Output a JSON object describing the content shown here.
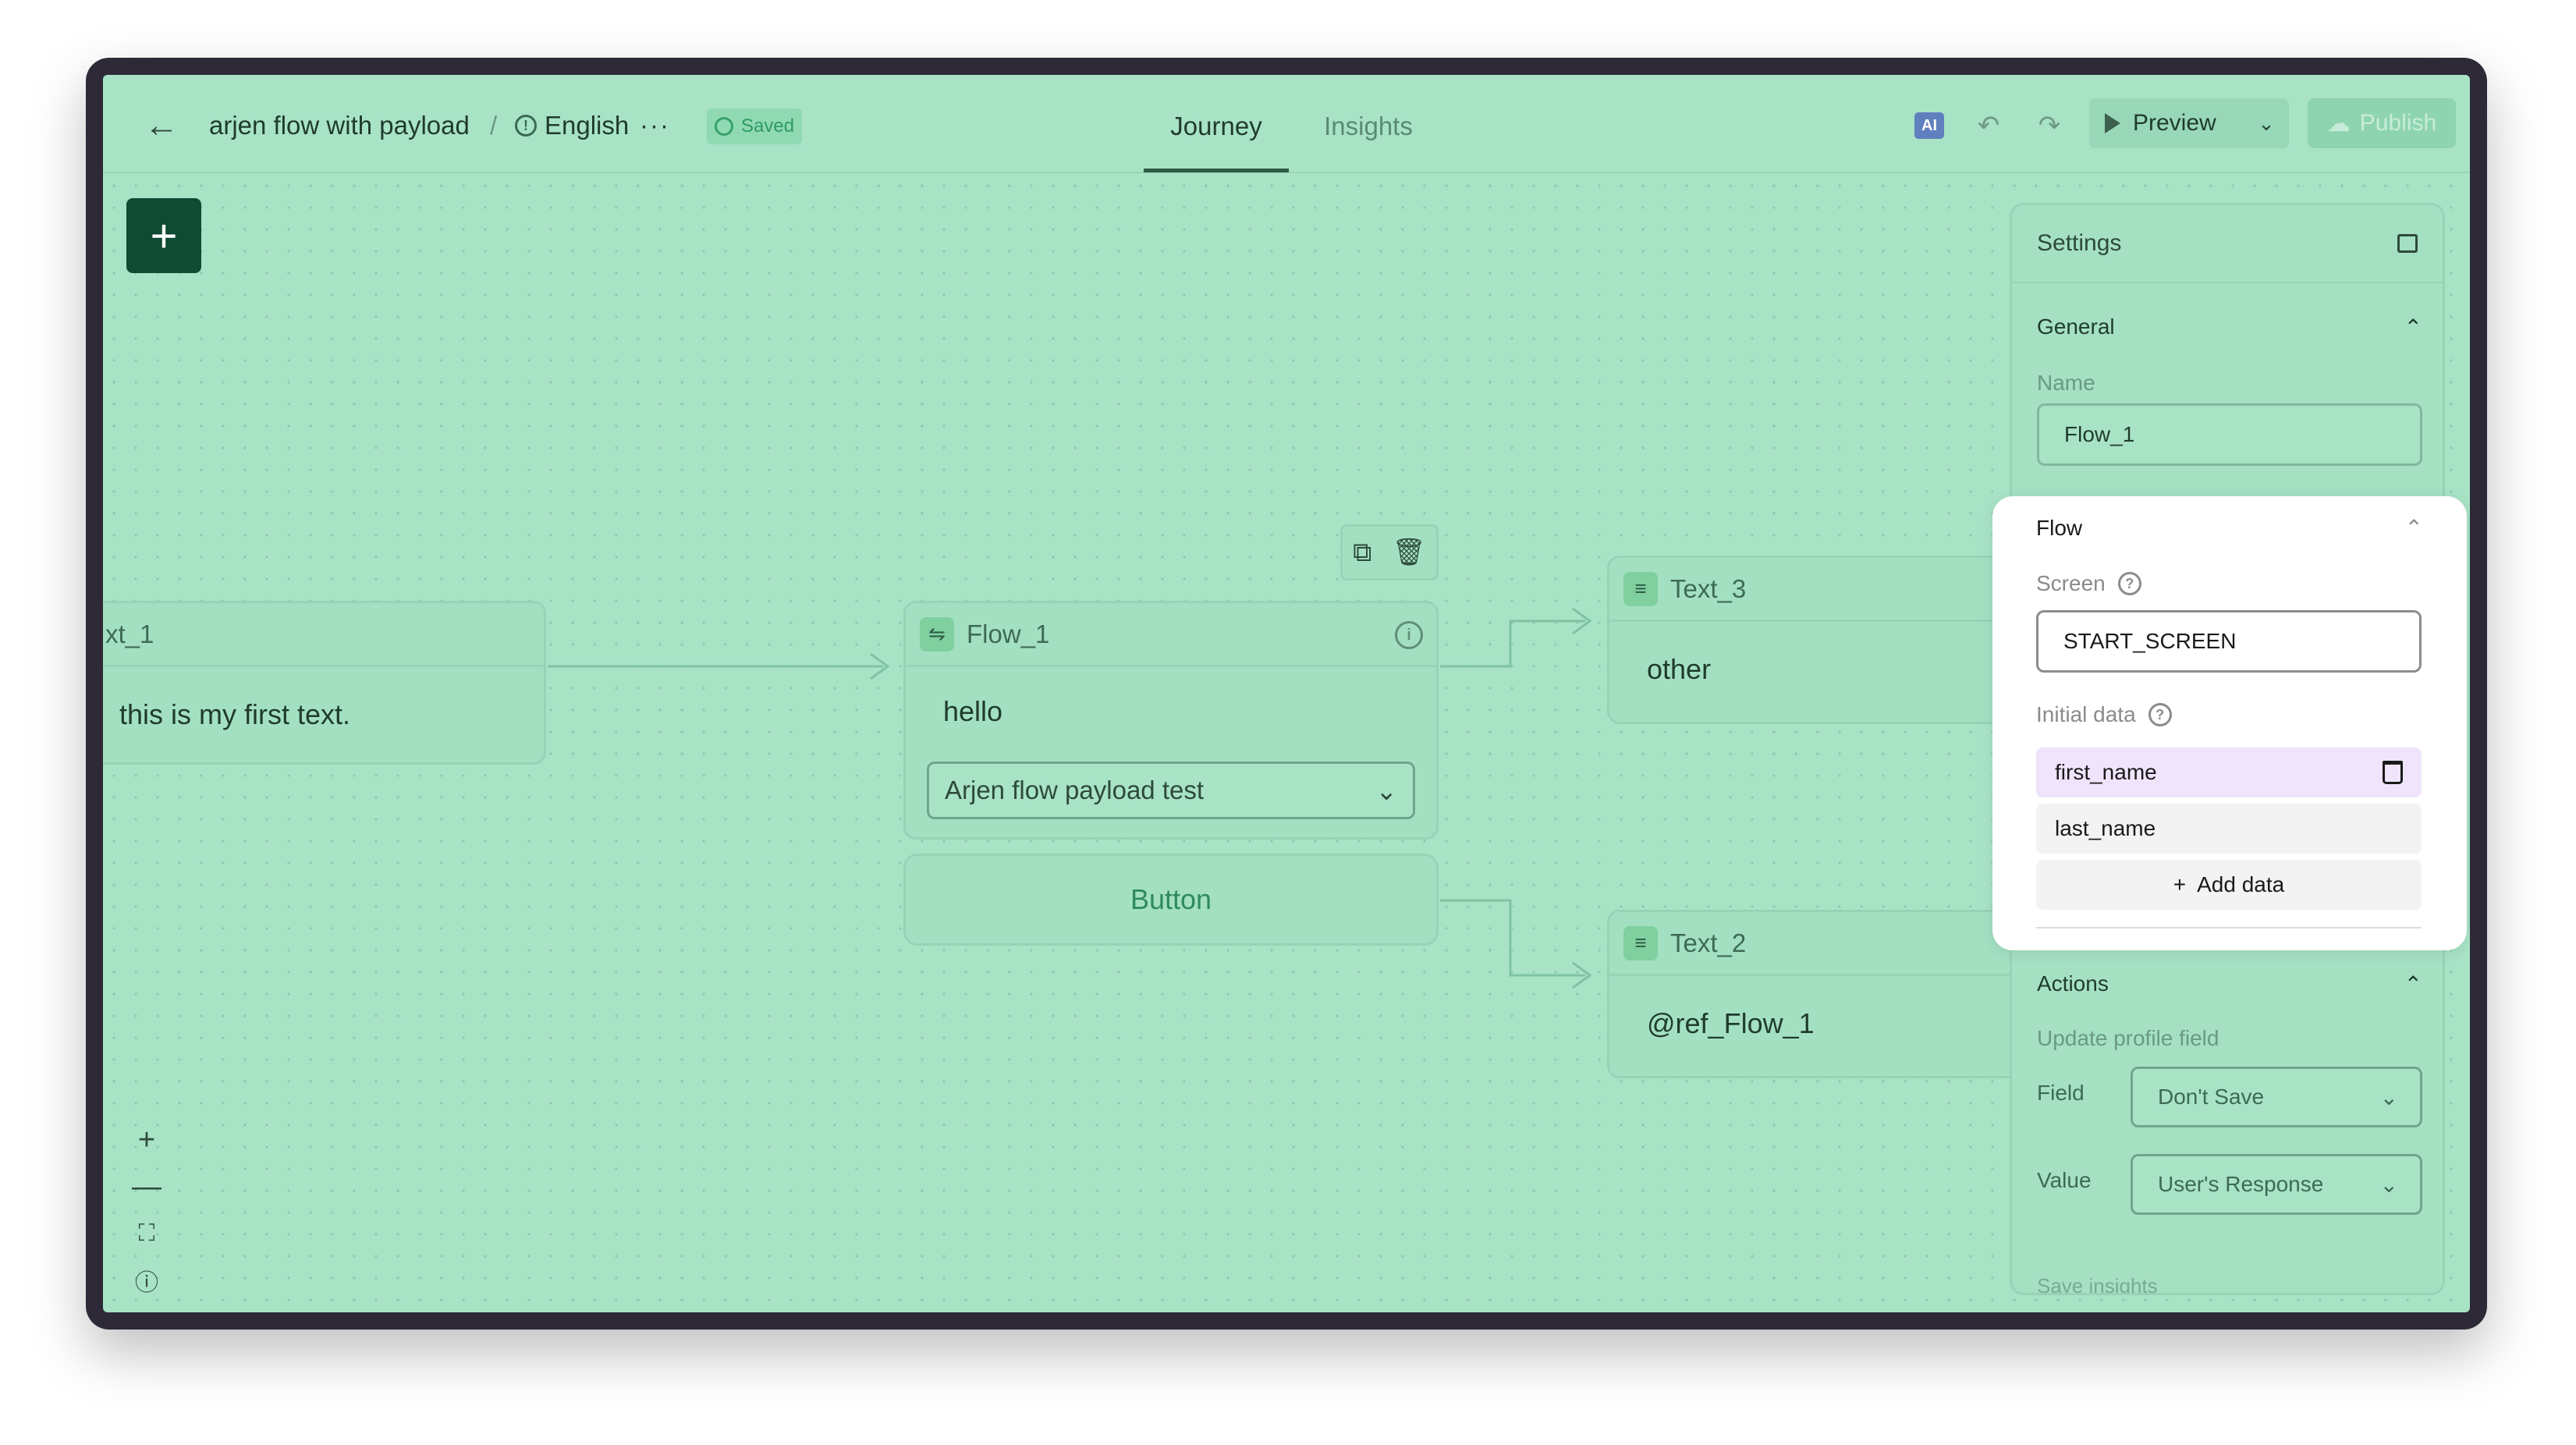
{
  "header": {
    "title": "arjen flow with payload",
    "separator": "/",
    "language": "English",
    "more": "···",
    "saved": "Saved",
    "tabs": [
      {
        "label": "Journey"
      },
      {
        "label": "Insights"
      }
    ],
    "ai_label": "AI",
    "preview": "Preview",
    "publish": "Publish"
  },
  "canvas": {
    "nodes": {
      "text1": {
        "title": "xt_1",
        "body": "this is my first text."
      },
      "flow1": {
        "title": "Flow_1",
        "body": "hello",
        "flow_select": "Arjen flow payload test"
      },
      "button": {
        "label": "Button"
      },
      "text3": {
        "title": "Text_3",
        "body": "other"
      },
      "text2": {
        "title": "Text_2",
        "body": "@ref_Flow_1"
      }
    }
  },
  "settings": {
    "title": "Settings",
    "general": {
      "heading": "General",
      "name_label": "Name",
      "name_value": "Flow_1"
    },
    "flow": {
      "heading": "Flow",
      "screen_label": "Screen",
      "screen_value": "START_SCREEN",
      "initial_data_label": "Initial data",
      "items": [
        {
          "label": "first_name"
        },
        {
          "label": "last_name"
        }
      ],
      "add_label": "Add data"
    },
    "actions": {
      "heading": "Actions",
      "subheading": "Update profile field",
      "field_label": "Field",
      "field_value": "Don't Save",
      "value_label": "Value",
      "value_value": "User's Response",
      "more": "Save insights"
    }
  },
  "colors": {
    "canvas": "#a8e3c6",
    "accent": "#0f4a33",
    "highlight_card": "#ffffff",
    "chip_selected": "#efe4fb"
  }
}
